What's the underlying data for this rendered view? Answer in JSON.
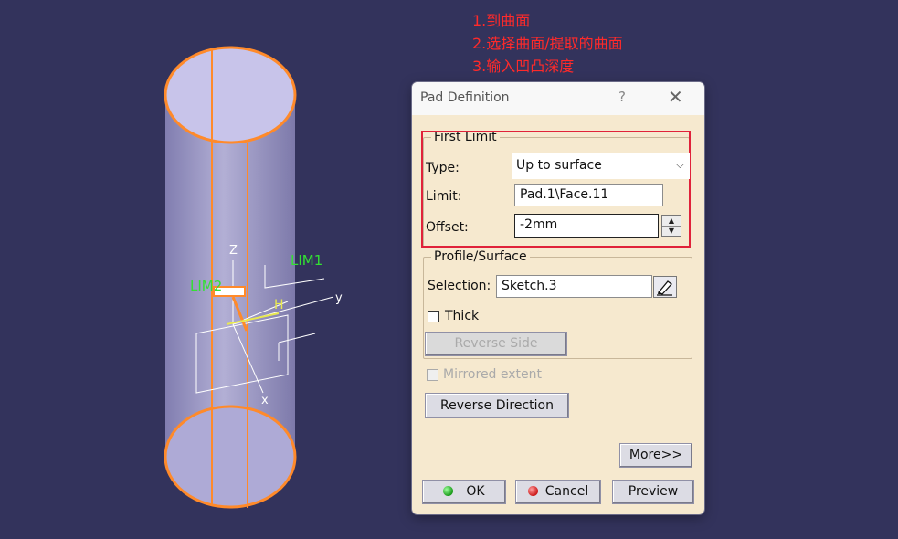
{
  "annotations": [
    "1.到曲面",
    "2.选择曲面/提取的曲面",
    "3.输入凹凸深度"
  ],
  "viewport": {
    "axis_labels": {
      "z": "Z",
      "y": "y",
      "x": "x",
      "h": "H"
    },
    "limit_labels": {
      "lim1": "LIM1",
      "lim2": "LIM2"
    },
    "colors": {
      "background": "#33335c",
      "edge": "#ff8a2a",
      "cylinder": "#c7c3e8",
      "label": "#33e033",
      "wire": "#ffffff"
    }
  },
  "dialog": {
    "title": "Pad Definition",
    "help": "?",
    "close": "✕",
    "first_limit": {
      "legend": "First Limit",
      "type_label": "Type:",
      "type_value": "Up to surface",
      "limit_label": "Limit:",
      "limit_value": "Pad.1\\Face.11",
      "offset_label": "Offset:",
      "offset_value": "-2mm"
    },
    "profile_surface": {
      "legend": "Profile/Surface",
      "selection_label": "Selection:",
      "selection_value": "Sketch.3",
      "thick_label": "Thick",
      "thick_checked": false,
      "reverse_side": "Reverse Side"
    },
    "mirrored_extent": "Mirrored extent",
    "reverse_direction": "Reverse Direction",
    "more": "More>>",
    "ok": "OK",
    "cancel": "Cancel",
    "preview": "Preview",
    "icons": {
      "ok": "green-dot-icon",
      "cancel": "red-dot-icon",
      "selection": "edit-pencil-icon",
      "spin_up": "arrow-up-icon",
      "spin_down": "arrow-down-icon",
      "dropdown": "chevron-down-icon"
    }
  }
}
